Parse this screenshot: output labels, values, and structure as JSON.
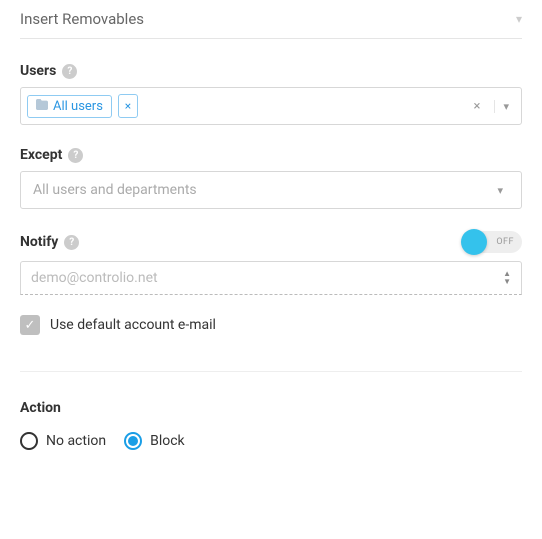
{
  "header": {
    "title": "Insert Removables"
  },
  "users": {
    "label": "Users",
    "chip_text": "All users"
  },
  "except": {
    "label": "Except",
    "placeholder": "All users and departments"
  },
  "notify": {
    "label": "Notify",
    "toggle_state": "OFF",
    "input_value": "demo@controlio.net",
    "checkbox_label": "Use default account e-mail"
  },
  "action": {
    "label": "Action",
    "option1": "No action",
    "option2": "Block",
    "selected": "Block"
  }
}
